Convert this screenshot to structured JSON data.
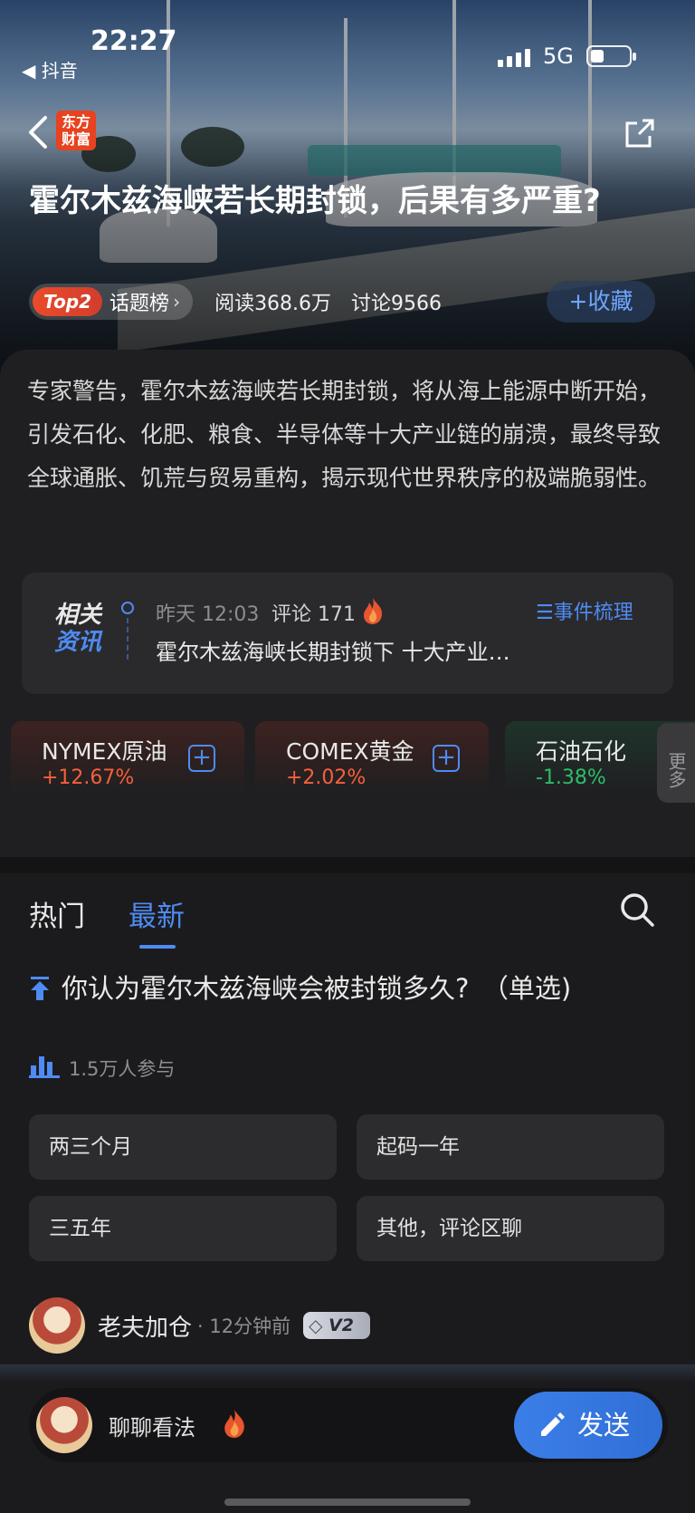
{
  "status_bar": {
    "time": "22:27",
    "back_app": "◀ 抖音",
    "network": "5G"
  },
  "header": {
    "logo_text": "东方财富",
    "title": "霍尔木兹海峡若长期封锁，后果有多严重?",
    "rank_badge": "Top2",
    "rank_label": "话题榜",
    "reads": "阅读368.6万",
    "discussions": "讨论9566",
    "favorite_button": "+收藏"
  },
  "intro": "专家警告，霍尔木兹海峡若长期封锁，将从海上能源中断开始，引发石化、化肥、粮食、半导体等十大产业链的崩溃，最终导致全球通胀、饥荒与贸易重构，揭示现代世界秩序的极端脆弱性。",
  "related_news": {
    "label_line1": "相关",
    "label_line2": "资讯",
    "time": "昨天 12:03",
    "comments": "评论 171",
    "events_link": "☰事件梳理",
    "headline": "霍尔木兹海峡长期封锁下 十大产业…"
  },
  "tickers": [
    {
      "name": "NYMEX原油",
      "change": "+12.67%",
      "direction": "up"
    },
    {
      "name": "COMEX黄金",
      "change": "+2.02%",
      "direction": "up"
    },
    {
      "name": "石油石化",
      "change": "-1.38%",
      "direction": "down"
    }
  ],
  "more_button": "更多",
  "feed": {
    "tabs": [
      {
        "label": "热门",
        "active": false
      },
      {
        "label": "最新",
        "active": true
      }
    ],
    "poll": {
      "question": "你认为霍尔木兹海峡会被封锁多久?　（单选)",
      "participants": "1.5万人参与",
      "options": [
        "两三个月",
        "起码一年",
        "三五年",
        "其他，评论区聊"
      ]
    },
    "post": {
      "username": "老夫加仓",
      "time": "· 12分钟前",
      "level": "V2"
    }
  },
  "bottom_bar": {
    "placeholder": "聊聊看法",
    "send_button": "发送"
  },
  "colors": {
    "accent_blue": "#4e8bf2",
    "up_red": "#f5603b",
    "down_green": "#2fbd6a",
    "logo_red": "#e8421e"
  }
}
